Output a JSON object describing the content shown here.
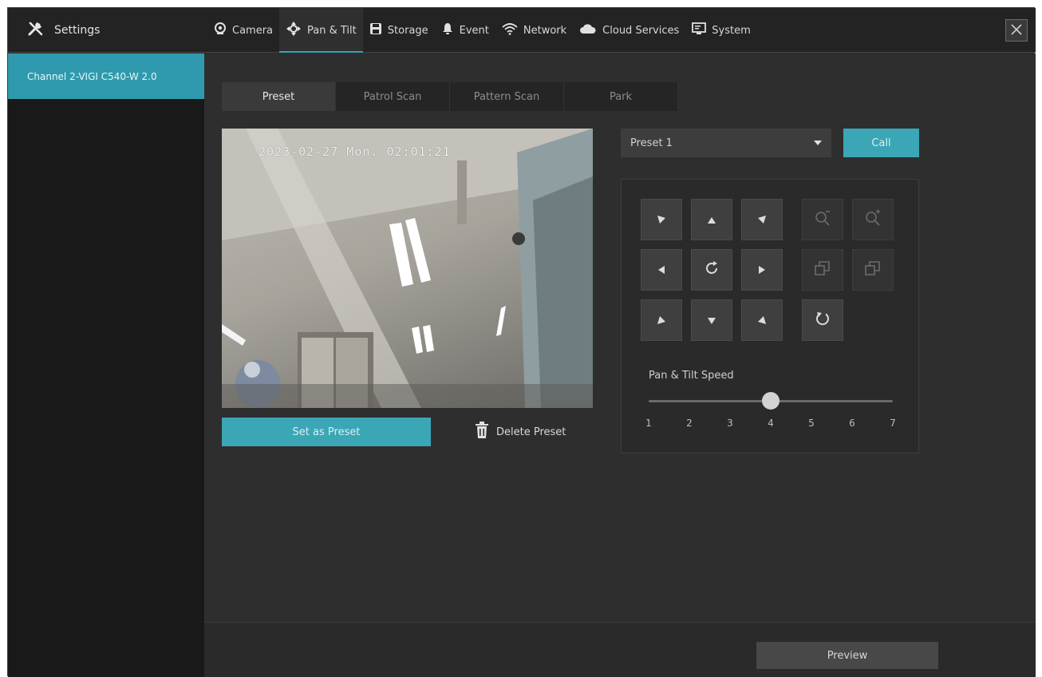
{
  "header": {
    "settings_label": "Settings",
    "tabs": [
      {
        "label": "Camera",
        "icon": "camera-icon"
      },
      {
        "label": "Pan & Tilt",
        "icon": "pan-tilt-icon",
        "active": true
      },
      {
        "label": "Storage",
        "icon": "storage-icon"
      },
      {
        "label": "Event",
        "icon": "bell-icon"
      },
      {
        "label": "Network",
        "icon": "wifi-icon"
      },
      {
        "label": "Cloud Services",
        "icon": "cloud-icon"
      },
      {
        "label": "System",
        "icon": "monitor-icon"
      }
    ]
  },
  "sidebar": {
    "channels": [
      {
        "label": "Channel 2-VIGI C540-W 2.0",
        "selected": true
      }
    ]
  },
  "subtabs": [
    {
      "label": "Preset",
      "active": true
    },
    {
      "label": "Patrol Scan"
    },
    {
      "label": "Pattern Scan"
    },
    {
      "label": "Park"
    }
  ],
  "video": {
    "timestamp": "2023-02-27 Mon. 02:01:21"
  },
  "preset": {
    "set_label": "Set as Preset",
    "delete_label": "Delete Preset",
    "selected": "Preset 1",
    "call_label": "Call"
  },
  "ptz": {
    "speed_label": "Pan & Tilt Speed",
    "speed_ticks": [
      "1",
      "2",
      "3",
      "4",
      "5",
      "6",
      "7"
    ],
    "speed_value": 4
  },
  "footer": {
    "preview_label": "Preview"
  },
  "colors": {
    "accent": "#36a3b5",
    "background": "#2e2e2e",
    "sidebar": "#191919"
  }
}
